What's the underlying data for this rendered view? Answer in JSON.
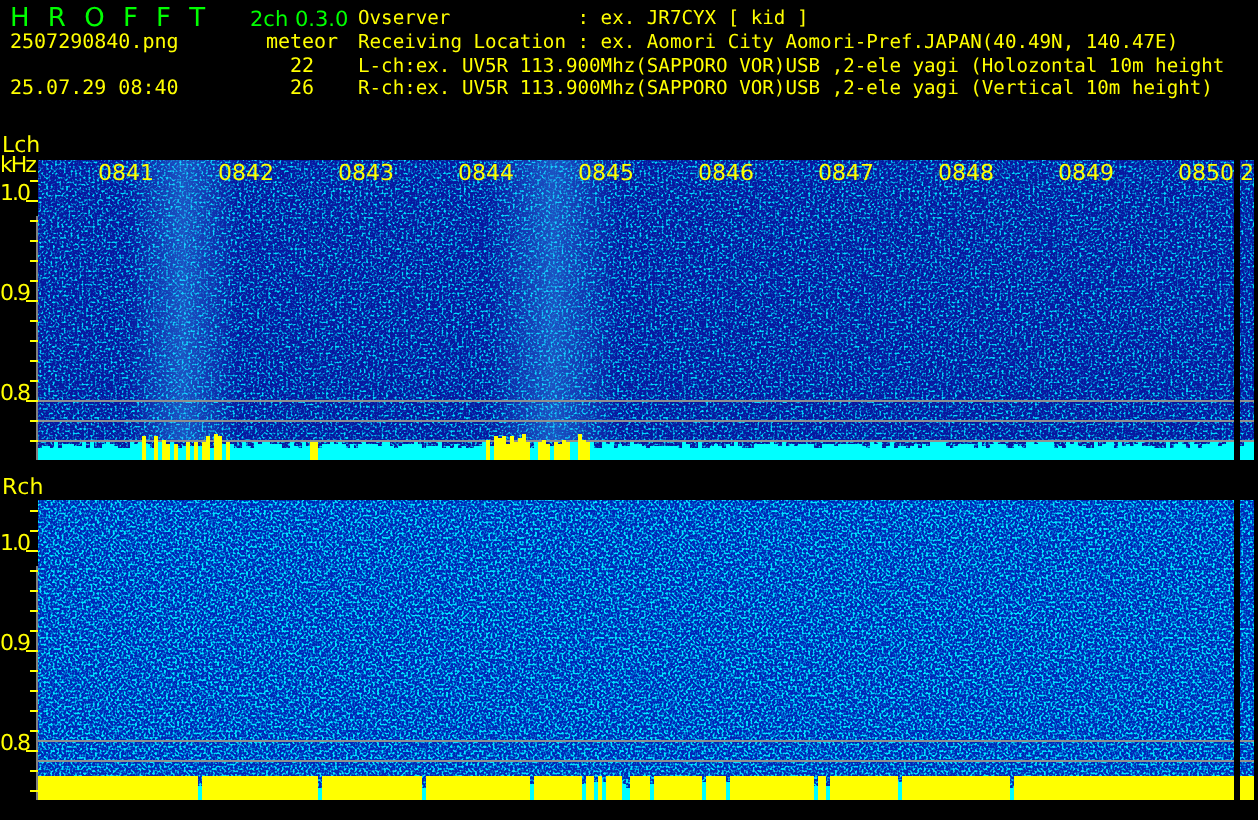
{
  "header": {
    "app_name": "H R O F F T",
    "version": "2ch 0.3.0",
    "file_name": "2507290840.png",
    "date_time": "25.07.29 08:40",
    "meteor_label": "meteor",
    "meteor_counts": [
      "22",
      "26"
    ],
    "info_lines": [
      "Ovserver           : ex. JR7CYX [ kid ]",
      "Receiving Location : ex. Aomori City Aomori-Pref.JAPAN(40.49N, 140.47E)",
      "L-ch:ex. UV5R 113.900Mhz(SAPPORO VOR)USB ,2-ele yagi (Holozontal 10m height",
      "R-ch:ex. UV5R 113.900Mhz(SAPPORO VOR)USB ,2-ele yagi (Vertical 10m height)"
    ]
  },
  "panels": [
    {
      "channel": "Lch",
      "unit": "kHz",
      "time_labels": [
        "0841",
        "0842",
        "0843",
        "0844",
        "0845",
        "0846",
        "0847",
        "0848",
        "0849",
        "0850"
      ],
      "next_label": "2",
      "freq_labels": [
        "1.0",
        "0.9",
        "0.8"
      ]
    },
    {
      "channel": "Rch",
      "freq_labels": [
        "1.0",
        "0.9",
        "0.8"
      ]
    }
  ]
}
